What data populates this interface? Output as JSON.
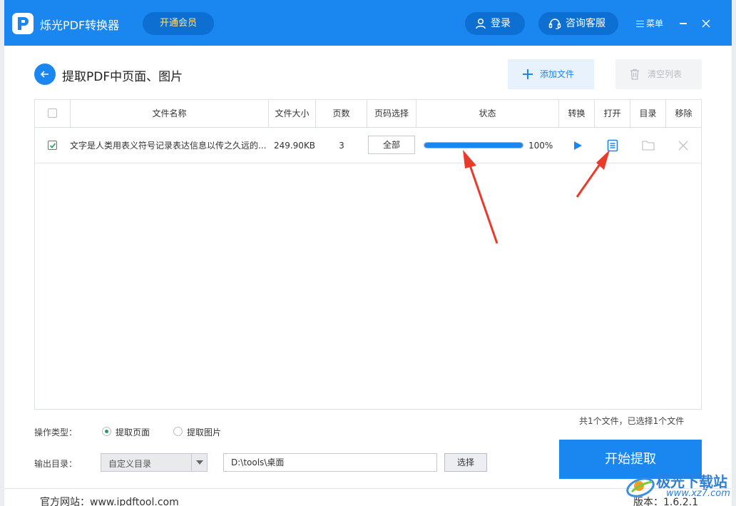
{
  "app": {
    "title": "烁光PDF转换器",
    "vip_label": "开通会员",
    "login_label": "登录",
    "service_label": "咨询客服",
    "menu_label": "菜单"
  },
  "page": {
    "title": "提取PDF中页面、图片",
    "add_label": "添加文件",
    "clear_label": "清空列表"
  },
  "table": {
    "headers": {
      "name": "文件名称",
      "size": "文件大小",
      "pages": "页数",
      "range": "页码选择",
      "status": "状态",
      "convert": "转换",
      "open": "打开",
      "folder": "目录",
      "remove": "移除"
    },
    "rows": [
      {
        "name": "文字是人类用表义符号记录表达信息以传之久远的...",
        "size": "249.90KB",
        "pages": "3",
        "range": "全部",
        "progress": 100,
        "progress_text": "100%"
      }
    ]
  },
  "summary": "共1个文件，已选择1个文件",
  "options": {
    "op_label": "操作类型：",
    "op_pages": "提取页面",
    "op_images": "提取图片",
    "out_label": "输出目录：",
    "out_mode": "自定义目录",
    "out_path": "D:\\tools\\桌面",
    "choose_label": "选择",
    "start_label": "开始提取"
  },
  "footer": {
    "website": "官方网站：www.ipdftool.com",
    "version": "版本：1.6.2.1"
  },
  "watermark": {
    "line1": "极光下载站",
    "line2": "www.xz7.com"
  },
  "colors": {
    "accent": "#1a87f0",
    "arrow": "#ea3a2a",
    "check": "#1aa260"
  }
}
